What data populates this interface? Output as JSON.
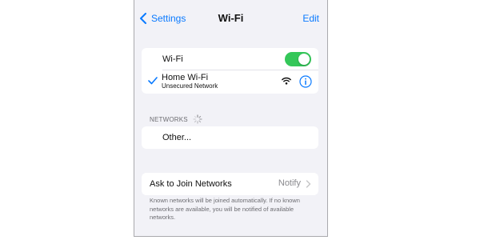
{
  "nav": {
    "back_label": "Settings",
    "title": "Wi-Fi",
    "edit_label": "Edit"
  },
  "wifi_group": {
    "toggle_label": "Wi-Fi",
    "toggle_on": true,
    "connected_network": {
      "name": "Home Wi-Fi",
      "subtitle": "Unsecured Network"
    }
  },
  "networks": {
    "header": "NETWORKS",
    "other_label": "Other..."
  },
  "ask_to_join": {
    "label": "Ask to Join Networks",
    "value": "Notify",
    "footer": "Known networks will be joined automatically. If no known networks are available, you will be notified of available networks."
  },
  "colors": {
    "accent": "#0a7aff",
    "toggle_on": "#34c759",
    "background": "#f2f2f7"
  },
  "icons": [
    "chevron-left-icon",
    "checkmark-icon",
    "wifi-icon",
    "info-icon",
    "spinner-icon",
    "chevron-right-icon"
  ]
}
